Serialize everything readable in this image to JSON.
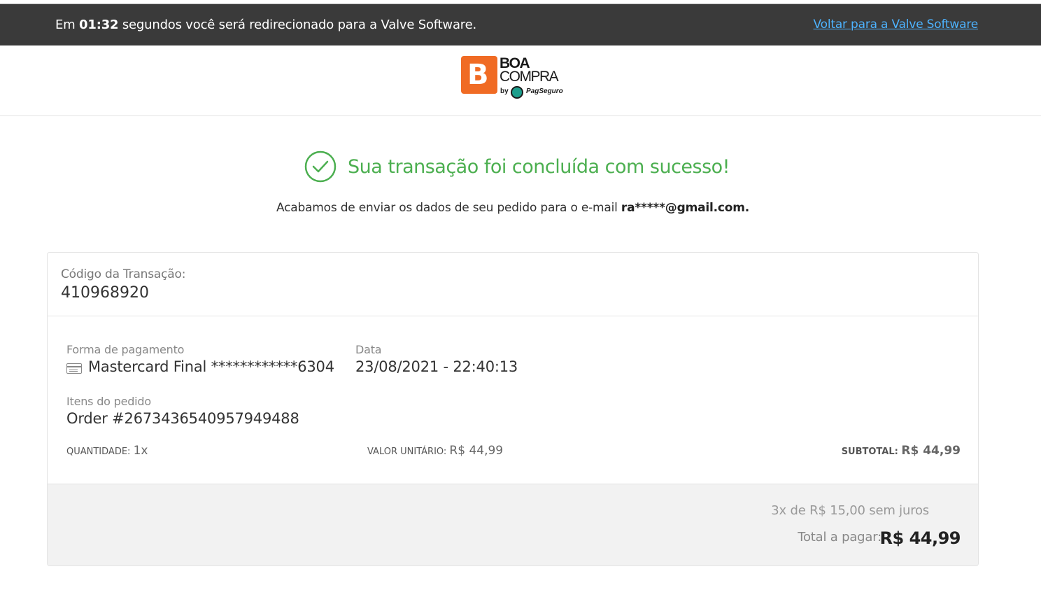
{
  "redirect_bar": {
    "prefix": "Em",
    "countdown": "01:32",
    "suffix": "segundos você será redirecionado para a Valve Software.",
    "back_link": "Voltar para a Valve Software"
  },
  "logo": {
    "line1": "BOA",
    "line2": "COMPRA",
    "by": "by",
    "partner": "PagSeguro",
    "mark": "B"
  },
  "success": {
    "title": "Sua transação foi concluída com sucesso!",
    "email_prefix": "Acabamos de enviar os dados de seu pedido para o e-mail",
    "email": "ra*****@gmail.com."
  },
  "transaction": {
    "code_label": "Código da Transação:",
    "code": "410968920"
  },
  "payment": {
    "method_label": "Forma de pagamento",
    "method_value": "Mastercard Final ************6304",
    "date_label": "Data",
    "date_value": "23/08/2021 - 22:40:13",
    "items_label": "Itens do pedido",
    "item_name": "Order #2673436540957949488",
    "quantity_label": "QUANTIDADE:",
    "quantity_value": "1x",
    "unit_label": "VALOR UNITÁRIO:",
    "unit_value": "R$ 44,99",
    "subtotal_label": "SUBTOTAL:",
    "subtotal_value": "R$ 44,99"
  },
  "totals": {
    "installments": "3x de R$ 15,00 sem juros",
    "total_label": "Total a pagar:",
    "total_value": "R$ 44,99"
  },
  "colors": {
    "topbar": "#3a3a3a",
    "link": "#4db3ff",
    "success": "#4caf50",
    "brand": "#f06b24"
  },
  "icons": [
    "check-circle-icon",
    "credit-card-icon"
  ]
}
